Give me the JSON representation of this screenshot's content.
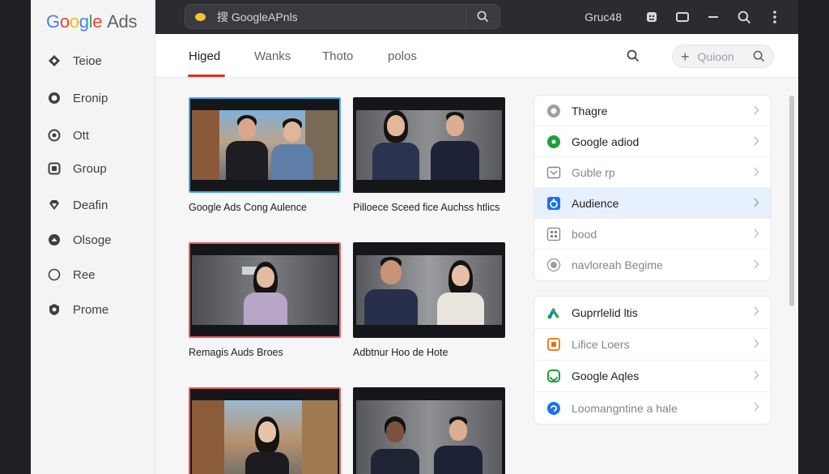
{
  "brand": {
    "google": "Google",
    "ads": "Ads"
  },
  "sidebar": {
    "items": [
      {
        "label": "Teioe",
        "icon": "diamond-icon"
      },
      {
        "label": "Eronip",
        "icon": "ring-icon"
      },
      {
        "label": "Ott",
        "icon": "target-icon"
      },
      {
        "label": "Group",
        "icon": "square-icon"
      },
      {
        "label": "Deafin",
        "icon": "gem-icon"
      },
      {
        "label": "Olsoge",
        "icon": "circle-chevron-icon"
      },
      {
        "label": "Ree",
        "icon": "circle-icon"
      },
      {
        "label": "Prome",
        "icon": "shield-icon"
      }
    ]
  },
  "topbar": {
    "search_text": "搜 GoogleAPnls",
    "user": "Gruc48",
    "icons": [
      "account-icon",
      "window-icon",
      "minimize-icon",
      "search-icon",
      "more-icon"
    ]
  },
  "tabs": [
    {
      "label": "Higed",
      "active": true
    },
    {
      "label": "Wanks",
      "active": false
    },
    {
      "label": "Thoto",
      "active": false
    },
    {
      "label": "polos",
      "active": false
    }
  ],
  "filter": {
    "placeholder": "Quioon"
  },
  "videos": [
    {
      "caption": "Google Ads Cong Aulence",
      "border": "blue"
    },
    {
      "caption": "Pilloece Sceed fice Auchss htlics",
      "border": "none"
    },
    {
      "caption": "Remagis Auds Broes",
      "border": "red"
    },
    {
      "caption": "Adbtnur Hoo de Hote",
      "border": "none"
    },
    {
      "caption": "",
      "border": "red"
    },
    {
      "caption": "",
      "border": "none"
    }
  ],
  "panels": [
    {
      "rows": [
        {
          "label": "Thagre",
          "icon": "clock-icon",
          "muted": false,
          "highlight": false
        },
        {
          "label": "Google adiod",
          "icon": "green-dot-icon",
          "muted": false,
          "highlight": false
        },
        {
          "label": "Guble rp",
          "icon": "checkbox-icon",
          "muted": true,
          "highlight": false
        },
        {
          "label": "Audience",
          "icon": "audience-icon",
          "muted": false,
          "highlight": true
        },
        {
          "label": "bood",
          "icon": "grid-icon",
          "muted": true,
          "highlight": false
        },
        {
          "label": "navloreah Begime",
          "icon": "radio-icon",
          "muted": true,
          "highlight": false
        }
      ]
    },
    {
      "rows": [
        {
          "label": "Guprrlelid ltis",
          "icon": "ads-logo-icon",
          "muted": false,
          "highlight": false
        },
        {
          "label": "Lifice Loers",
          "icon": "orange-tag-icon",
          "muted": true,
          "highlight": false
        },
        {
          "label": "Google Aqles",
          "icon": "green-frame-icon",
          "muted": false,
          "highlight": false
        },
        {
          "label": "Loomangntine a hale",
          "icon": "blue-circle-icon",
          "muted": true,
          "highlight": false
        }
      ]
    }
  ],
  "colors": {
    "accent_red": "#d93025",
    "highlight_blue": "#e7f0fd",
    "topbar": "#2b2c30",
    "thumb_blue": "#45a9e8",
    "thumb_red": "#ea5a5a"
  }
}
